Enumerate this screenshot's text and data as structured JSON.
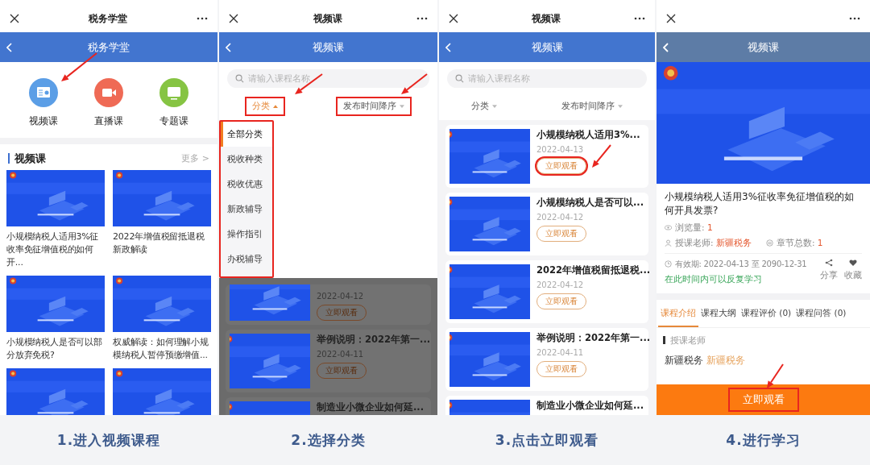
{
  "home": {
    "top_title": "税务学堂",
    "nav_title": "税务学堂",
    "categories": [
      {
        "label": "视频课",
        "color": "#5b9ee6",
        "annotated": true
      },
      {
        "label": "直播课",
        "color": "#ef6a55",
        "annotated": false
      },
      {
        "label": "专题课",
        "color": "#86c443",
        "annotated": false
      }
    ],
    "section_title": "视频课",
    "more": "更多 >",
    "courses": [
      {
        "kind": "course",
        "title": "小规模纳税人适用3%征收率免征增值税的如何开..."
      },
      {
        "kind": "course",
        "title": "2022年增值税留抵退税新政解读"
      },
      {
        "kind": "course",
        "title": "小规模纳税人是否可以部分放弃免税?"
      },
      {
        "kind": "course",
        "title": "权威解读：如何理解小规模纳税人暂停预缴增值..."
      },
      {
        "kind": "picture"
      },
      {
        "kind": "picture"
      }
    ],
    "caption": "1.进入视频课程"
  },
  "filter": {
    "top_title": "视频课",
    "nav_title": "视频课",
    "search_placeholder": "请输入课程名称",
    "filters": [
      {
        "label": "分类",
        "active": true,
        "annotated": true
      },
      {
        "label": "发布时间降序",
        "active": false,
        "annotated": true
      }
    ],
    "dropdown": {
      "annotated": true,
      "items": [
        {
          "label": "全部分类",
          "selected": true
        },
        {
          "label": "税收种类",
          "selected": false
        },
        {
          "label": "税收优惠",
          "selected": false
        },
        {
          "label": "新政辅导",
          "selected": false
        },
        {
          "label": "操作指引",
          "selected": false
        },
        {
          "label": "办税辅导",
          "selected": false
        }
      ]
    },
    "list": [
      {
        "date": "2022-04-12",
        "button": "立即观看"
      },
      {
        "title": "举例说明：2022年第一...",
        "date": "2022-04-11",
        "button": "立即观看"
      },
      {
        "title": "制造业小微企业如何延..."
      }
    ],
    "caption": "2.选择分类"
  },
  "list": {
    "top_title": "视频课",
    "nav_title": "视频课",
    "search_placeholder": "请输入课程名称",
    "filters": [
      {
        "label": "分类",
        "active": false
      },
      {
        "label": "发布时间降序",
        "active": false
      }
    ],
    "courses": [
      {
        "title": "小规模纳税人适用3%...",
        "date": "2022-04-13",
        "button": "立即观看",
        "annotated": true
      },
      {
        "title": "小规模纳税人是否可以...",
        "date": "2022-04-12",
        "button": "立即观看",
        "annotated": false
      },
      {
        "title": "2022年增值税留抵退税...",
        "date": "2022-04-12",
        "button": "立即观看",
        "annotated": false
      },
      {
        "title": "举例说明：2022年第一...",
        "date": "2022-04-11",
        "button": "立即观看",
        "annotated": false
      },
      {
        "title": "制造业小微企业如何延..."
      }
    ],
    "caption": "3.点击立即观看"
  },
  "detail": {
    "nav_title": "视频课",
    "title": "小规模纳税人适用3%征收率免征增值税的如何开具发票?",
    "views": {
      "label": "浏览量:",
      "value": "1"
    },
    "teacher": {
      "label": "授课老师:",
      "value": "新疆税务"
    },
    "chapters": {
      "label": "章节总数:",
      "value": "1"
    },
    "validity": "有效期: 2022-04-13 至 2090-12-31",
    "validity_note": "在此时间内可以反复学习",
    "actions": [
      "分享",
      "收藏"
    ],
    "tabs": [
      {
        "label": "课程介绍",
        "selected": true
      },
      {
        "label": "课程大纲",
        "selected": false
      },
      {
        "label": "课程评价 (0)",
        "selected": false
      },
      {
        "label": "课程问答 (0)",
        "selected": false
      }
    ],
    "section_label": "授课老师",
    "teacher_name": "新疆税务",
    "teacher_org": "新疆税务",
    "watch": {
      "label": "立即观看",
      "annotated": true
    },
    "caption": "4.进行学习"
  }
}
